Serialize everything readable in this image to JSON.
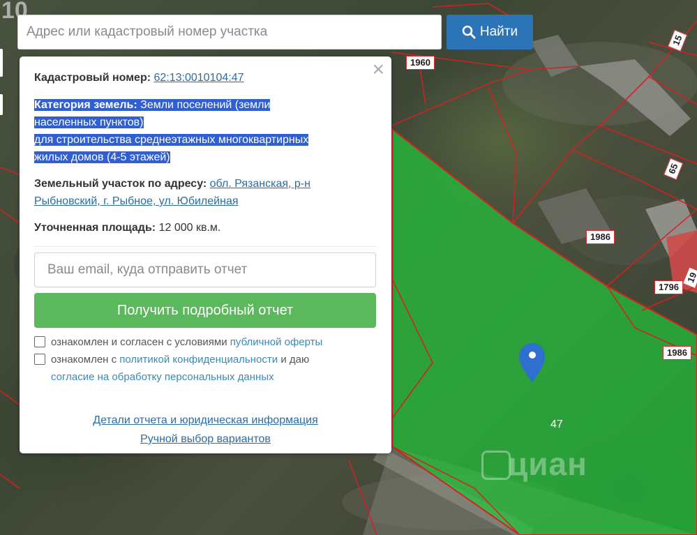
{
  "map": {
    "corner_label": "10",
    "parcel_numbers": [
      "1960",
      "15",
      "65",
      "1986",
      "1796",
      "19",
      "1986"
    ],
    "parcel_label_inside": "47",
    "watermark": "циан",
    "colors": {
      "selected_parcel": "#22c43a",
      "parcel_border": "#d62020"
    }
  },
  "search": {
    "placeholder": "Адрес или кадастровый номер участка",
    "value": "",
    "button_label": "Найти",
    "button_icon": "search-icon"
  },
  "popup": {
    "close_icon": "close-icon",
    "cadastral_label": "Кадастровый номер:",
    "cadastral_value": "62:13:0010104:47",
    "category_label": "Категория земель:",
    "category_value": "Земли поселений (земли",
    "category_value_2": "населенных пунктов)",
    "usage_line_1": "для строительства среднеэтажных многоквартирных",
    "usage_line_2": "жилых домов (4-5 этажей)",
    "address_label": "Земельный участок по адресу:",
    "address_line_1": "обл. Рязанская, р-н",
    "address_line_2": "Рыбновский, г. Рыбное, ул. Юбилейная",
    "area_label": "Уточненная площадь:",
    "area_value": "12 000 кв.м.",
    "email_placeholder": "Ваш email, куда отправить отчет",
    "email_value": "",
    "report_button": "Получить подробный отчет",
    "consent_1_text": "ознакомлен и согласен с условиями",
    "consent_1_link": "публичной оферты",
    "consent_2_text_a": "ознакомлен с",
    "consent_2_link_a": "политикой конфиденциальности",
    "consent_2_text_b": "и даю",
    "consent_2_link_b": "согласие на обработку персональных данных",
    "details_link": "Детали отчета и юридическая информация",
    "manual_link": "Ручной выбор вариантов"
  }
}
